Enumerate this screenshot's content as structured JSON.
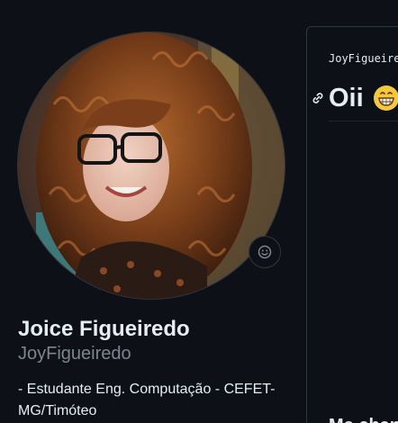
{
  "profile": {
    "full_name": "Joice Figueiredo",
    "username": "JoyFigueiredo",
    "bio": "- Estudante Eng. Computação - CEFET-MG/Timóteo"
  },
  "readme": {
    "path": "JoyFigueiredo",
    "heading": "Oii",
    "heading_emoji": "grinning-face-emoji",
    "paragraph": "Me chan"
  },
  "icons": {
    "status": "smiley-icon",
    "anchor": "link-icon"
  },
  "colors": {
    "background": "#0d1117",
    "border": "#30363d",
    "text": "#e6edf3",
    "muted": "#7d8590"
  }
}
